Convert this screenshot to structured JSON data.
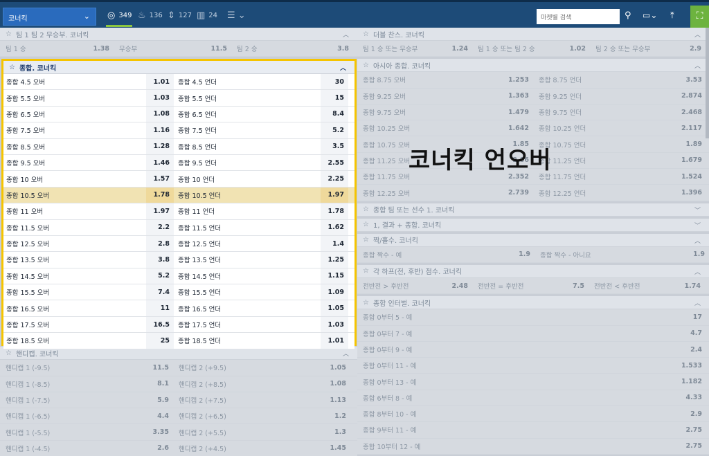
{
  "topbar": {
    "dropdown_label": "코너킥",
    "filters": [
      {
        "icon": "target-icon",
        "count": "349"
      },
      {
        "icon": "fire-icon",
        "count": "136"
      },
      {
        "icon": "updown-icon",
        "count": "127"
      },
      {
        "icon": "stats-icon",
        "count": "24"
      }
    ],
    "search_placeholder": "마켓별 검색"
  },
  "overlay_caption": "코너킥 언오버",
  "left_top_section": {
    "title": "팀 1 팀 2 무승부. 코너킥",
    "row": [
      {
        "label": "팀 1 승",
        "odd": "1.38"
      },
      {
        "label": "무승부",
        "odd": "11.5"
      },
      {
        "label": "팀 2 승",
        "odd": "3.8"
      }
    ]
  },
  "totals_section": {
    "title": "종합. 코너킥",
    "rows": [
      {
        "over": "종합 4.5 오버",
        "over_odd": "1.01",
        "under": "종합 4.5 언더",
        "under_odd": "30"
      },
      {
        "over": "종합 5.5 오버",
        "over_odd": "1.03",
        "under": "종합 5.5 언더",
        "under_odd": "15"
      },
      {
        "over": "종합 6.5 오버",
        "over_odd": "1.08",
        "under": "종합 6.5 언더",
        "under_odd": "8.4"
      },
      {
        "over": "종합 7.5 오버",
        "over_odd": "1.16",
        "under": "종합 7.5 언더",
        "under_odd": "5.2"
      },
      {
        "over": "종합 8.5 오버",
        "over_odd": "1.28",
        "under": "종합 8.5 언더",
        "under_odd": "3.5"
      },
      {
        "over": "종합 9.5 오버",
        "over_odd": "1.46",
        "under": "종합 9.5 언더",
        "under_odd": "2.55"
      },
      {
        "over": "종합 10 오버",
        "over_odd": "1.57",
        "under": "종합 10 언더",
        "under_odd": "2.25"
      },
      {
        "over": "종합 10.5 오버",
        "over_odd": "1.78",
        "under": "종합 10.5 언더",
        "under_odd": "1.97"
      },
      {
        "over": "종합 11 오버",
        "over_odd": "1.97",
        "under": "종합 11 언더",
        "under_odd": "1.78"
      },
      {
        "over": "종합 11.5 오버",
        "over_odd": "2.2",
        "under": "종합 11.5 언더",
        "under_odd": "1.62"
      },
      {
        "over": "종합 12.5 오버",
        "over_odd": "2.8",
        "under": "종합 12.5 언더",
        "under_odd": "1.4"
      },
      {
        "over": "종합 13.5 오버",
        "over_odd": "3.8",
        "under": "종합 13.5 언더",
        "under_odd": "1.25"
      },
      {
        "over": "종합 14.5 오버",
        "over_odd": "5.2",
        "under": "종합 14.5 언더",
        "under_odd": "1.15"
      },
      {
        "over": "종합 15.5 오버",
        "over_odd": "7.4",
        "under": "종합 15.5 언더",
        "under_odd": "1.09"
      },
      {
        "over": "종합 16.5 오버",
        "over_odd": "11",
        "under": "종합 16.5 언더",
        "under_odd": "1.05"
      },
      {
        "over": "종합 17.5 오버",
        "over_odd": "16.5",
        "under": "종합 17.5 언더",
        "under_odd": "1.03"
      },
      {
        "over": "종합 18.5 오버",
        "over_odd": "25",
        "under": "종합 18.5 언더",
        "under_odd": "1.01"
      }
    ]
  },
  "handicap_section": {
    "title": "핸디캡. 코너킥",
    "rows": [
      {
        "a": "핸디캡 1 (-9.5)",
        "a_odd": "11.5",
        "b": "핸디캡 2 (+9.5)",
        "b_odd": "1.05"
      },
      {
        "a": "핸디캡 1 (-8.5)",
        "a_odd": "8.1",
        "b": "핸디캡 2 (+8.5)",
        "b_odd": "1.08"
      },
      {
        "a": "핸디캡 1 (-7.5)",
        "a_odd": "5.9",
        "b": "핸디캡 2 (+7.5)",
        "b_odd": "1.13"
      },
      {
        "a": "핸디캡 1 (-6.5)",
        "a_odd": "4.4",
        "b": "핸디캡 2 (+6.5)",
        "b_odd": "1.2"
      },
      {
        "a": "핸디캡 1 (-5.5)",
        "a_odd": "3.35",
        "b": "핸디캡 2 (+5.5)",
        "b_odd": "1.3"
      },
      {
        "a": "핸디캡 1 (-4.5)",
        "a_odd": "2.6",
        "b": "핸디캡 2 (+4.5)",
        "b_odd": "1.45"
      }
    ]
  },
  "right": {
    "double_chance": {
      "title": "더블 찬스. 코너킥",
      "row": [
        {
          "label": "팀 1 승 또는 무승부",
          "odd": "1.24"
        },
        {
          "label": "팀 1 승 또는 팀 2 승",
          "odd": "1.02"
        },
        {
          "label": "팀 2 승 또는 무승부",
          "odd": "2.9"
        }
      ]
    },
    "asian_totals": {
      "title": "아시아 종합. 코너킥",
      "rows": [
        {
          "a": "종합 8.75 오버",
          "a_odd": "1.253",
          "b": "종합 8.75 언더",
          "b_odd": "3.53"
        },
        {
          "a": "종합 9.25 오버",
          "a_odd": "1.363",
          "b": "종합 9.25 언더",
          "b_odd": "2.874"
        },
        {
          "a": "종합 9.75 오버",
          "a_odd": "1.479",
          "b": "종합 9.75 언더",
          "b_odd": "2.468"
        },
        {
          "a": "종합 10.25 오버",
          "a_odd": "1.642",
          "b": "종합 10.25 언더",
          "b_odd": "2.117"
        },
        {
          "a": "종합 10.75 오버",
          "a_odd": "1.85",
          "b": "종합 10.75 언더",
          "b_odd": "1.89"
        },
        {
          "a": "종합 11.25 오버",
          "a_odd": "2.06",
          "b": "종합 11.25 언더",
          "b_odd": "1.679"
        },
        {
          "a": "종합 11.75 오버",
          "a_odd": "2.352",
          "b": "종합 11.75 언더",
          "b_odd": "1.524"
        },
        {
          "a": "종합 12.25 오버",
          "a_odd": "2.739",
          "b": "종합 12.25 언더",
          "b_odd": "1.396"
        }
      ]
    },
    "collapsed1": "종합 팀 또는 선수 1. 코너킥",
    "collapsed2": "1, 결과 + 종합. 코너킥",
    "odd_even": {
      "title": "짝/홀수. 코너킥",
      "row": [
        {
          "label": "종합 짝수 - 예",
          "odd": "1.9"
        },
        {
          "label": "종합 짝수 - 아니요",
          "odd": "1.9"
        }
      ]
    },
    "halves": {
      "title": "각 하프(전, 후반) 점수. 코너킥",
      "row": [
        {
          "label": "전반전 > 후반전",
          "odd": "2.48"
        },
        {
          "label": "전반전 = 후반전",
          "odd": "7.5"
        },
        {
          "label": "전반전 < 후반전",
          "odd": "1.74"
        }
      ]
    },
    "interval": {
      "title": "종합 인터벌. 코너킥",
      "rows": [
        {
          "label": "종합 0부터 5 - 예",
          "odd": "17"
        },
        {
          "label": "종합 0부터 7 - 예",
          "odd": "4.7"
        },
        {
          "label": "종합 0부터 9 - 예",
          "odd": "2.4"
        },
        {
          "label": "종합 0부터 11 - 예",
          "odd": "1.533"
        },
        {
          "label": "종합 0부터 13 - 예",
          "odd": "1.182"
        },
        {
          "label": "종합 6부터 8 - 예",
          "odd": "4.33"
        },
        {
          "label": "종합 8부터 10 - 예",
          "odd": "2.9"
        },
        {
          "label": "종합 9부터 11 - 예",
          "odd": "2.75"
        },
        {
          "label": "종합 10부터 12 - 예",
          "odd": "2.75"
        }
      ]
    }
  }
}
